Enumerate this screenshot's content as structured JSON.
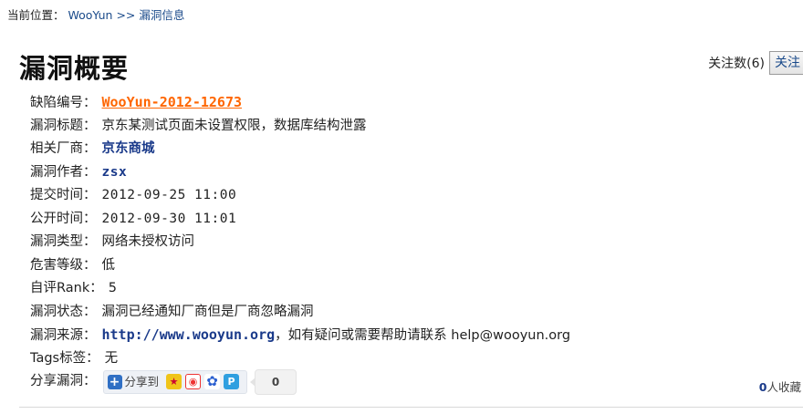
{
  "breadcrumb": {
    "prefix": "当前位置：",
    "home": "WooYun",
    "separator": ">>",
    "current": "漏洞信息"
  },
  "page": {
    "title": "漏洞概要"
  },
  "follow": {
    "count_text": "关注数(6)",
    "button_label": "关注"
  },
  "fields": {
    "id": {
      "label": "缺陷编号：",
      "value": "WooYun-2012-12673"
    },
    "title": {
      "label": "漏洞标题：",
      "value": "京东某测试页面未设置权限，数据库结构泄露"
    },
    "vendor": {
      "label": "相关厂商：",
      "value": "京东商城"
    },
    "author": {
      "label": "漏洞作者：",
      "value": "zsx"
    },
    "submit_time": {
      "label": "提交时间：",
      "value": "2012-09-25 11:00"
    },
    "public_time": {
      "label": "公开时间：",
      "value": "2012-09-30 11:01"
    },
    "type": {
      "label": "漏洞类型：",
      "value": "网络未授权访问"
    },
    "level": {
      "label": "危害等级：",
      "value": "低"
    },
    "rank": {
      "label": "自评Rank：",
      "value": "5"
    },
    "status": {
      "label": "漏洞状态：",
      "value": "漏洞已经通知厂商但是厂商忽略漏洞"
    },
    "source": {
      "label": "漏洞来源：",
      "url": "http://www.wooyun.org",
      "note": "，如有疑问或需要帮助请联系 help@wooyun.org"
    },
    "tags": {
      "label": "Tags标签：",
      "value": "无"
    }
  },
  "share": {
    "label": "分享漏洞：",
    "button_label": "分享到",
    "count": "0"
  },
  "collect": {
    "count": "0",
    "suffix": "人收藏"
  },
  "icons": [
    "share-plus-icon",
    "qzone-icon",
    "weibo-icon",
    "baidu-icon",
    "qq-icon"
  ]
}
